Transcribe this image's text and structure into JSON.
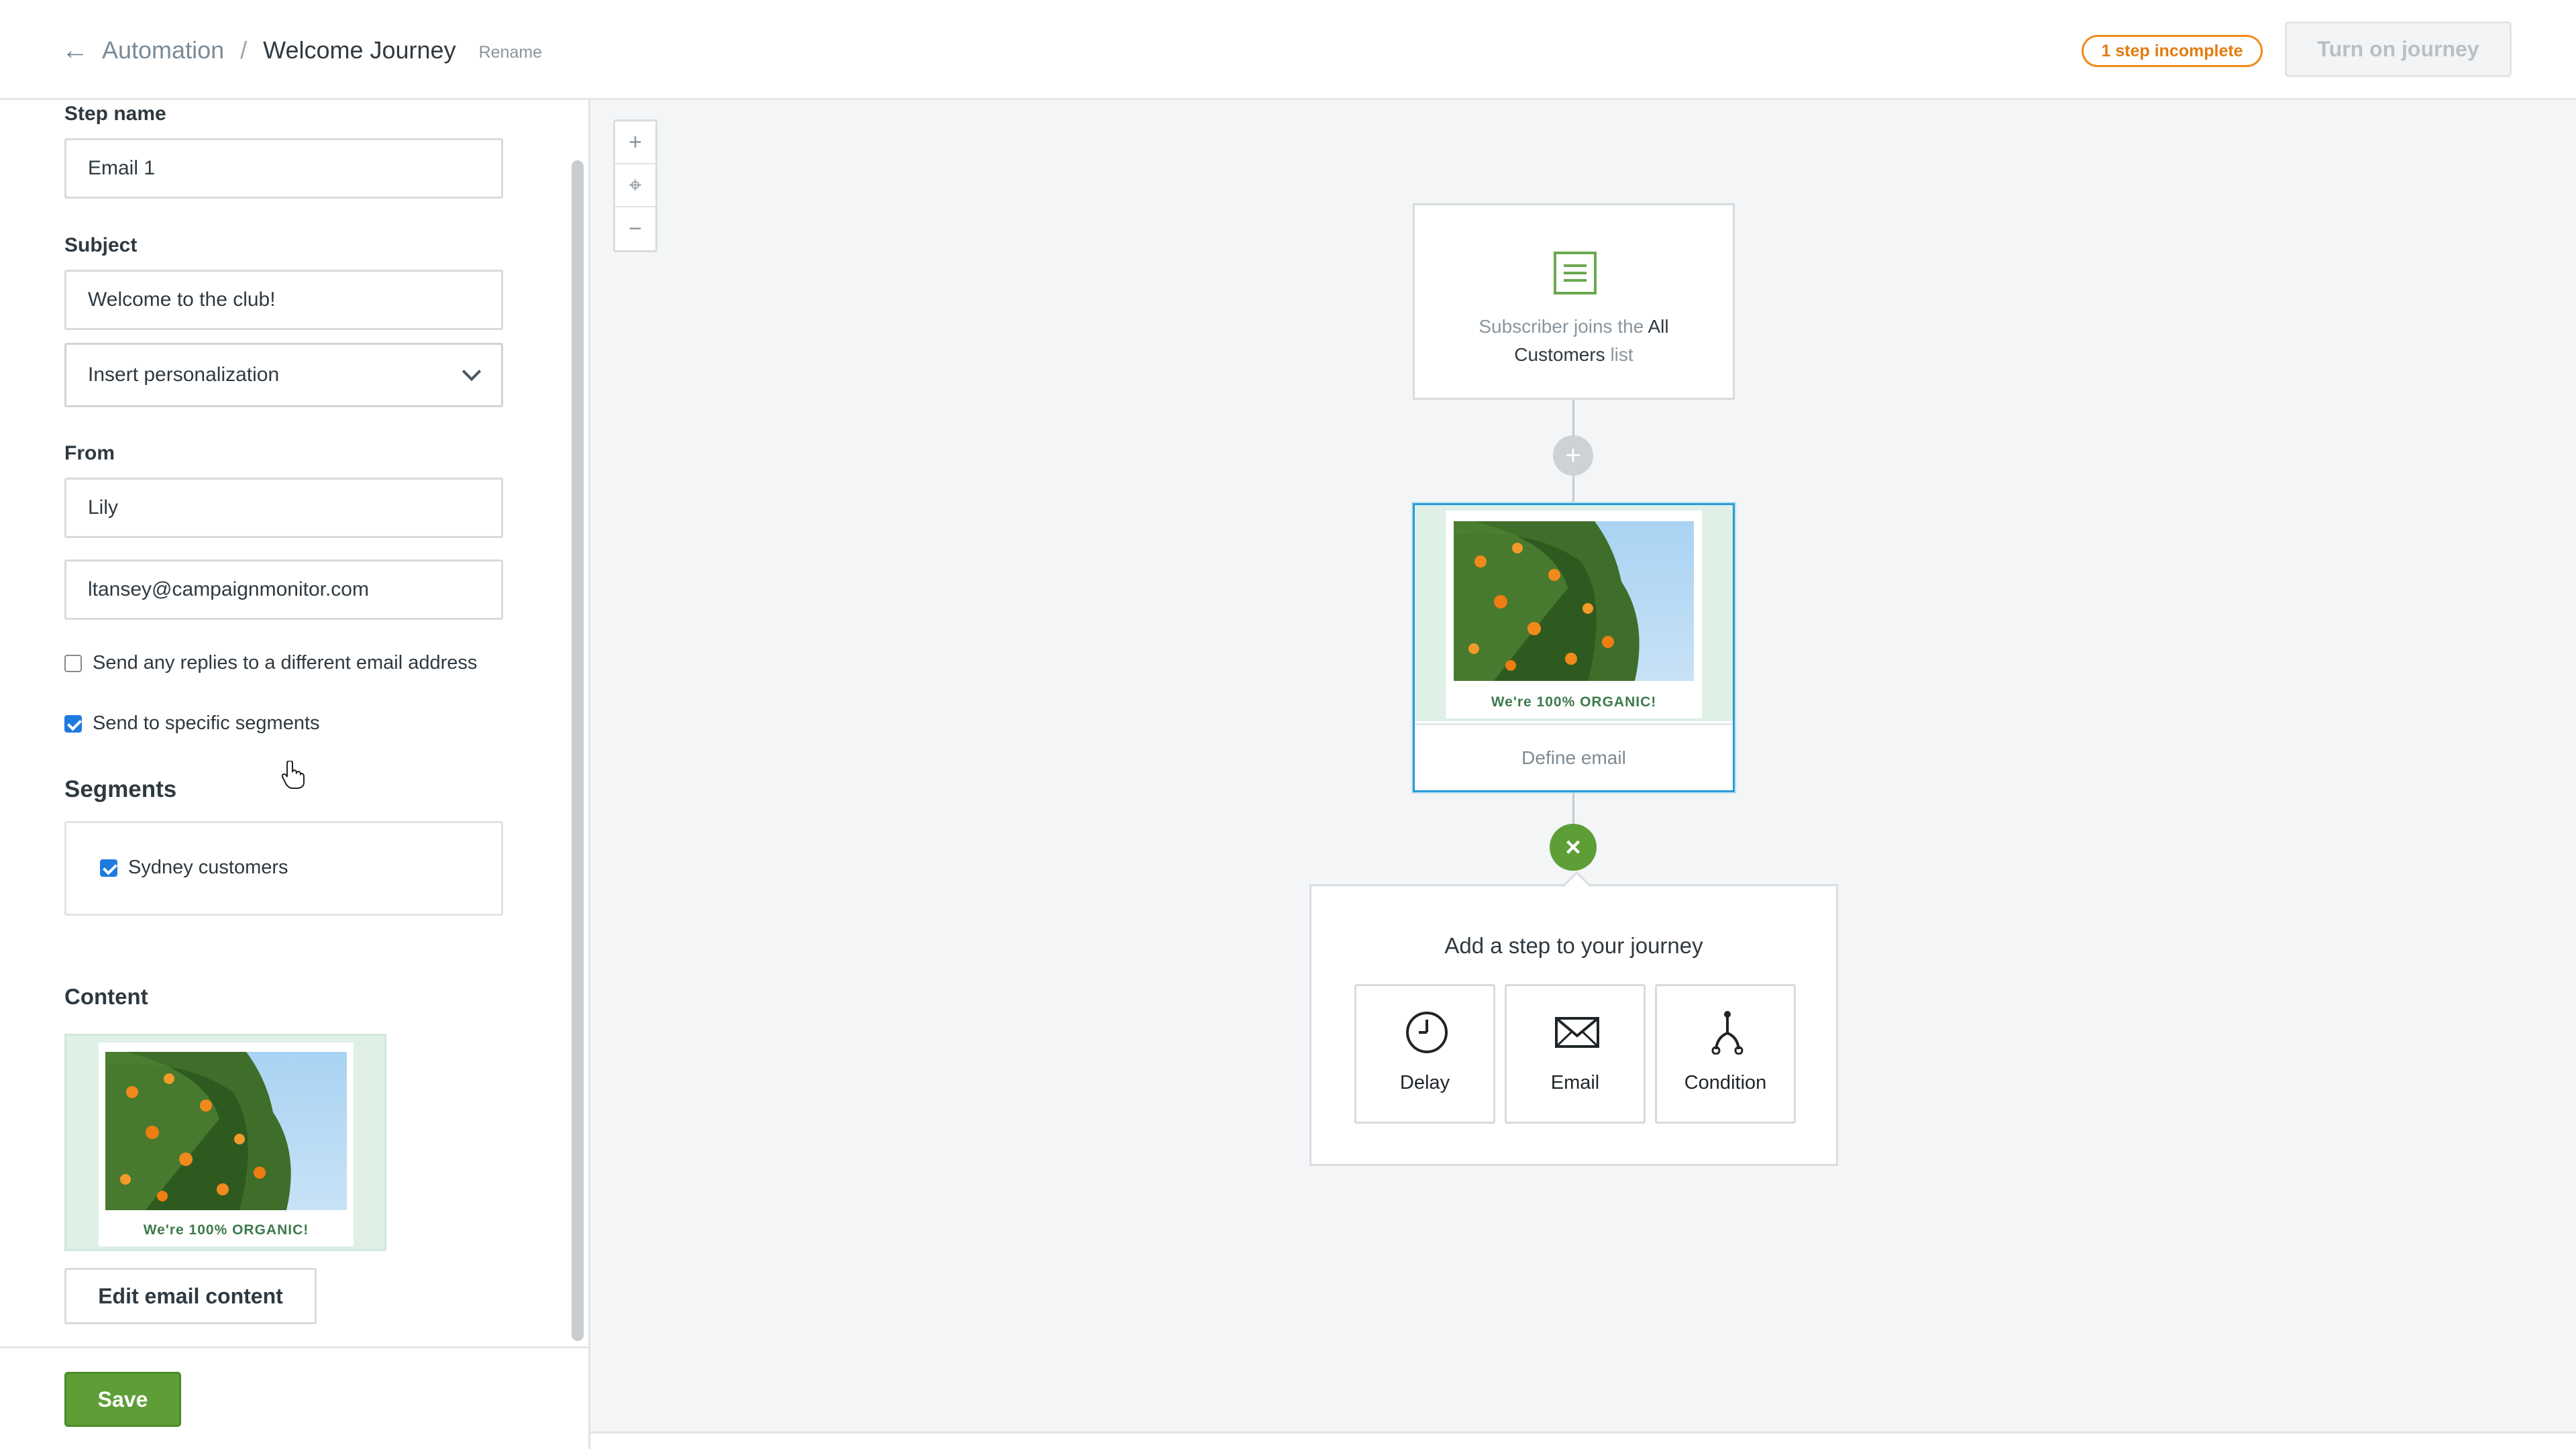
{
  "header": {
    "breadcrumb_parent": "Automation",
    "breadcrumb_separator": "/",
    "title": "Welcome Journey",
    "rename_label": "Rename",
    "status_badge": "1 step incomplete",
    "turn_on_label": "Turn on journey"
  },
  "sidebar": {
    "step_name_label": "Step name",
    "step_name_value": "Email 1",
    "subject_label": "Subject",
    "subject_value": "Welcome to the club!",
    "personalization_select": "Insert personalization",
    "from_label": "From",
    "from_name_value": "Lily",
    "from_email_value": "ltansey@campaignmonitor.com",
    "reply_checkbox_label": "Send any replies to a different email address",
    "reply_checkbox_checked": false,
    "segments_checkbox_label": "Send to specific segments",
    "segments_checkbox_checked": true,
    "segments_title": "Segments",
    "segments": [
      {
        "label": "Sydney customers",
        "checked": true
      }
    ],
    "content_title": "Content",
    "content_caption": "We're 100% ORGANIC!",
    "edit_content_label": "Edit email content",
    "save_label": "Save"
  },
  "canvas": {
    "zoom_controls": {
      "zoom_in": "+",
      "recenter": "⌖",
      "zoom_out": "−"
    },
    "trigger": {
      "prefix": "Subscriber joins the",
      "list_name": "All Customers",
      "suffix": "list"
    },
    "add_step_symbol": "+",
    "email_node": {
      "caption": "We're 100% ORGANIC!",
      "action_label": "Define email"
    },
    "close_symbol": "×",
    "add_step_popup": {
      "title": "Add a step to your journey",
      "options": [
        {
          "label": "Delay",
          "icon": "clock-icon"
        },
        {
          "label": "Email",
          "icon": "envelope-icon"
        },
        {
          "label": "Condition",
          "icon": "branch-icon"
        }
      ]
    }
  },
  "colors": {
    "accent_green": "#5d9e36",
    "badge_orange": "#f08a1c",
    "selected_blue": "#2a9ad8",
    "canvas_bg": "#f4f5f6"
  }
}
